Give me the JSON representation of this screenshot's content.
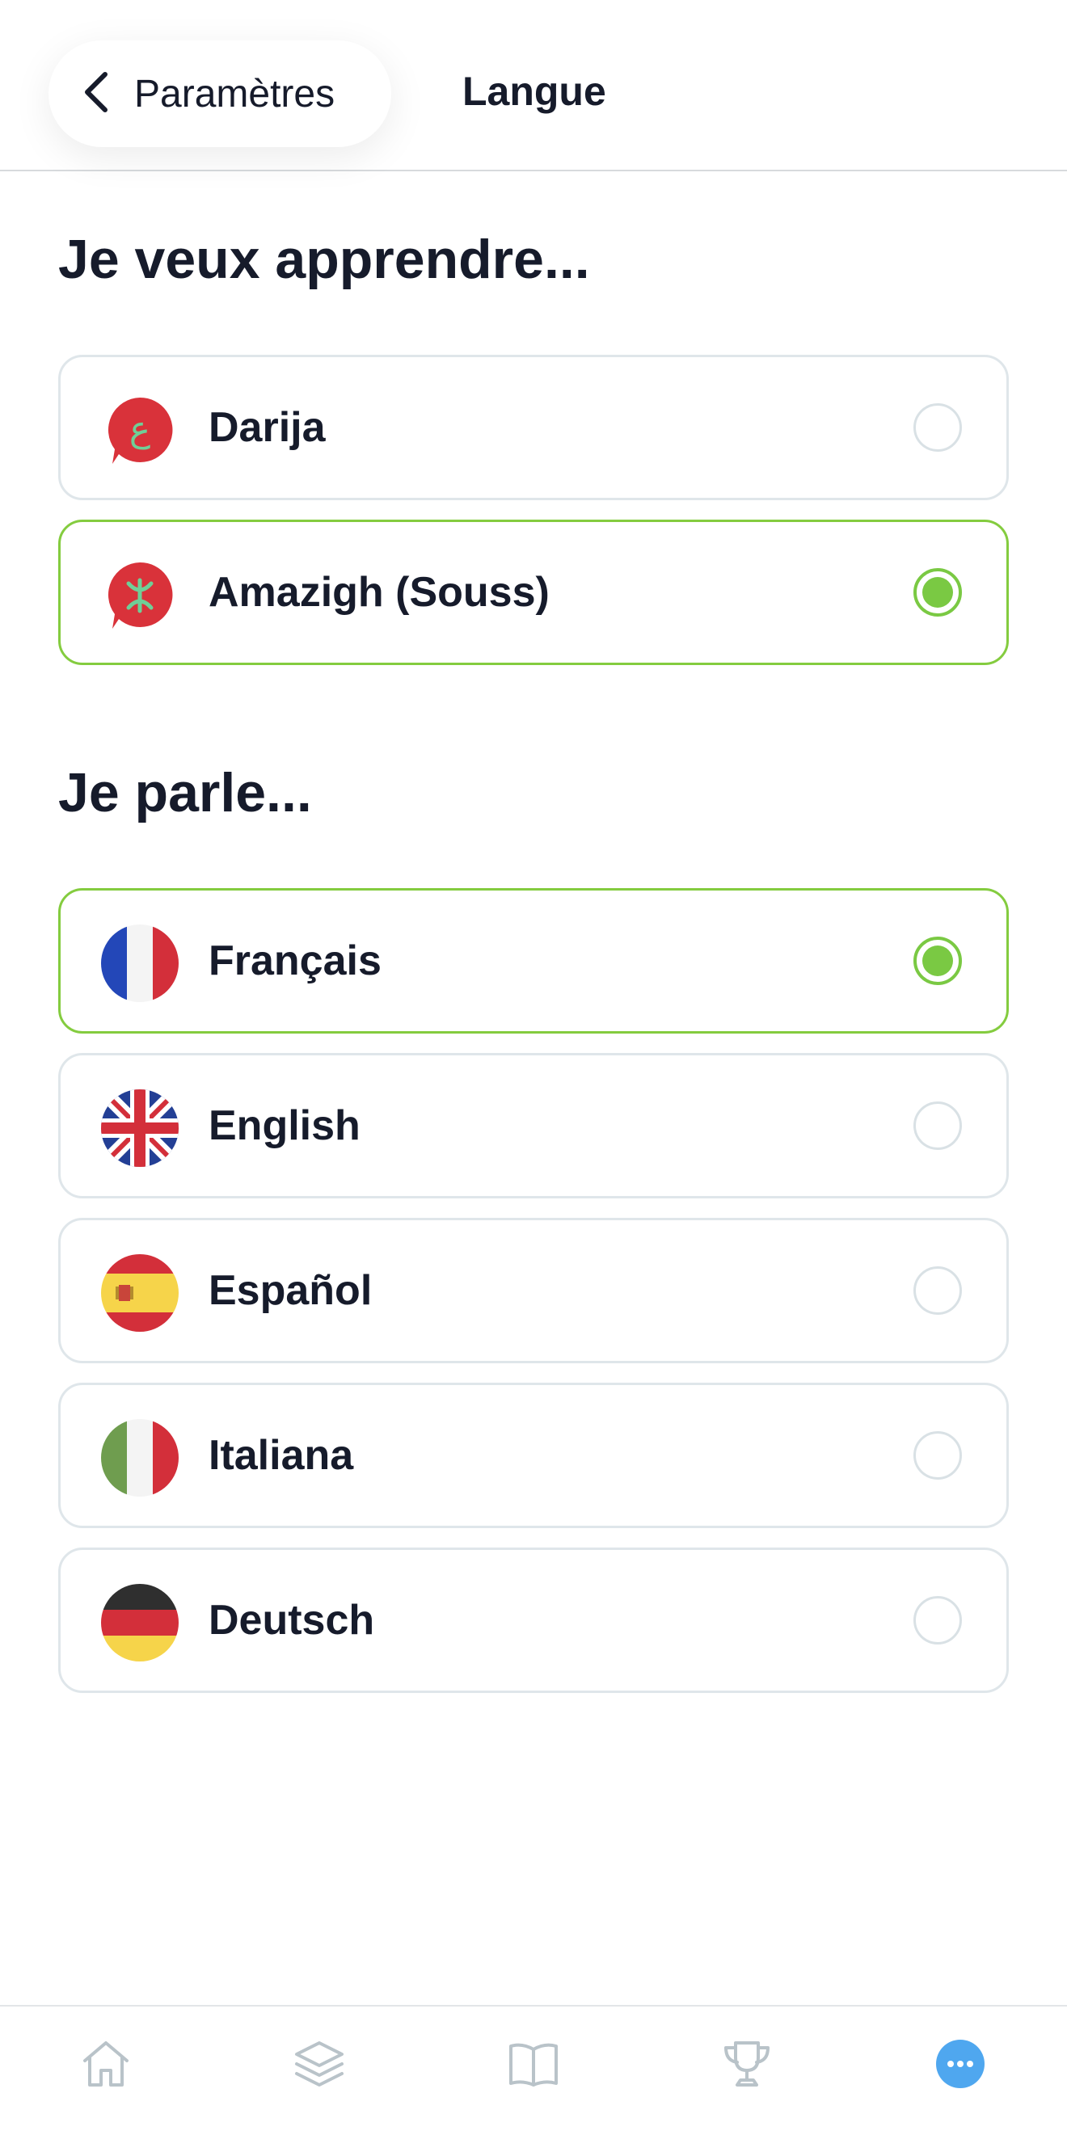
{
  "header": {
    "back_label": "Paramètres",
    "title": "Langue"
  },
  "learn": {
    "title": "Je veux apprendre...",
    "options": [
      {
        "label": "Darija",
        "icon": "darija-bubble-icon",
        "selected": false
      },
      {
        "label": "Amazigh (Souss)",
        "icon": "amazigh-bubble-icon",
        "selected": true
      }
    ]
  },
  "speak": {
    "title": "Je parle...",
    "options": [
      {
        "label": "Français",
        "icon": "french-flag-icon",
        "selected": true
      },
      {
        "label": "English",
        "icon": "uk-flag-icon",
        "selected": false
      },
      {
        "label": "Español",
        "icon": "spanish-flag-icon",
        "selected": false
      },
      {
        "label": "Italiana",
        "icon": "italian-flag-icon",
        "selected": false
      },
      {
        "label": "Deutsch",
        "icon": "german-flag-icon",
        "selected": false
      }
    ]
  },
  "bottom_nav": {
    "items": [
      "home-icon",
      "layers-icon",
      "book-icon",
      "trophy-icon",
      "more-icon"
    ],
    "active": "more-icon"
  },
  "colors": {
    "accent_green": "#7ac943",
    "selected_border": "#84cc3f",
    "bubble_red": "#d9323a",
    "nav_active_blue": "#4fa7ef",
    "nav_inactive": "#b9c3c9"
  }
}
